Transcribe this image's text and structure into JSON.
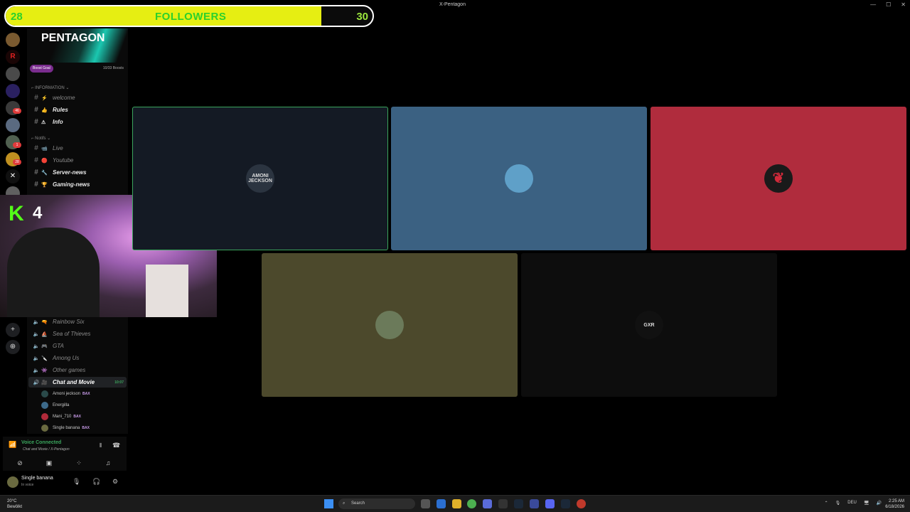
{
  "window": {
    "title": "X-Pentagon"
  },
  "followers": {
    "current": "28",
    "label": "FOLLOWERS",
    "goal": "30",
    "progress": 0.86
  },
  "server": {
    "name": "PENTAGON",
    "boost_label": "Boost Goal",
    "boost_count": "10/33 Boosts"
  },
  "categories": {
    "information": "INFORMATION",
    "notifs": "Notifs"
  },
  "text_channels": [
    {
      "name": "welcome",
      "emoji": "⚡",
      "bold": false
    },
    {
      "name": "Rules",
      "emoji": "👍",
      "bold": true
    },
    {
      "name": "Info",
      "emoji": "⚠",
      "bold": true
    },
    {
      "name": "Live",
      "emoji": "📹",
      "bold": false
    },
    {
      "name": "Youtube",
      "emoji": "🔴",
      "bold": false
    },
    {
      "name": "Server-news",
      "emoji": "🔧",
      "bold": true
    },
    {
      "name": "Gaming-news",
      "emoji": "🏆",
      "bold": true
    }
  ],
  "voice_channels": [
    {
      "name": "Rainbow Six",
      "emoji": "🔫"
    },
    {
      "name": "Sea of Thieves",
      "emoji": "⛵"
    },
    {
      "name": "GTA",
      "emoji": "🎮"
    },
    {
      "name": "Among Us",
      "emoji": "🔪"
    },
    {
      "name": "Other games",
      "emoji": "👾"
    }
  ],
  "active_voice": {
    "name": "Chat and Movie",
    "time": "10:07"
  },
  "members": [
    {
      "name": "Amoni jeckson",
      "tag": "BAX",
      "color": "#2a4a4a"
    },
    {
      "name": "Energilla",
      "tag": "",
      "color": "#3d6a8a"
    },
    {
      "name": "Mani_710",
      "tag": "BAX",
      "color": "#b02a3a"
    },
    {
      "name": "Single banana",
      "tag": "BAX",
      "color": "#6a6a40"
    }
  ],
  "voice_status": {
    "connected": "Voice Connected",
    "location": "Chat and Movie / X-Pentagon"
  },
  "user": {
    "name": "Single banana",
    "status": "In voice"
  },
  "webcam": {
    "brand": "K",
    "viewers": "4"
  },
  "tiles": [
    {
      "label": "AMONI JECKSON",
      "bg": "#141a24",
      "avatar_bg": "#2b3440"
    },
    {
      "label": "",
      "bg": "#3b6182",
      "avatar_bg": "#5fa0c8"
    },
    {
      "label": "",
      "bg": "#b02c3d",
      "avatar_bg": "#1a1a1a"
    },
    {
      "label": "",
      "bg": "#4c492c",
      "avatar_bg": "#6b7a5a"
    },
    {
      "label": "GXR",
      "bg": "#0d0d0d",
      "avatar_bg": "#111111"
    }
  ],
  "taskbar": {
    "weather_temp": "20°C",
    "weather_desc": "Bewölkt",
    "search": "Search",
    "lang": "DEU",
    "time": "2:25 AM",
    "date": "6/18/2026"
  }
}
